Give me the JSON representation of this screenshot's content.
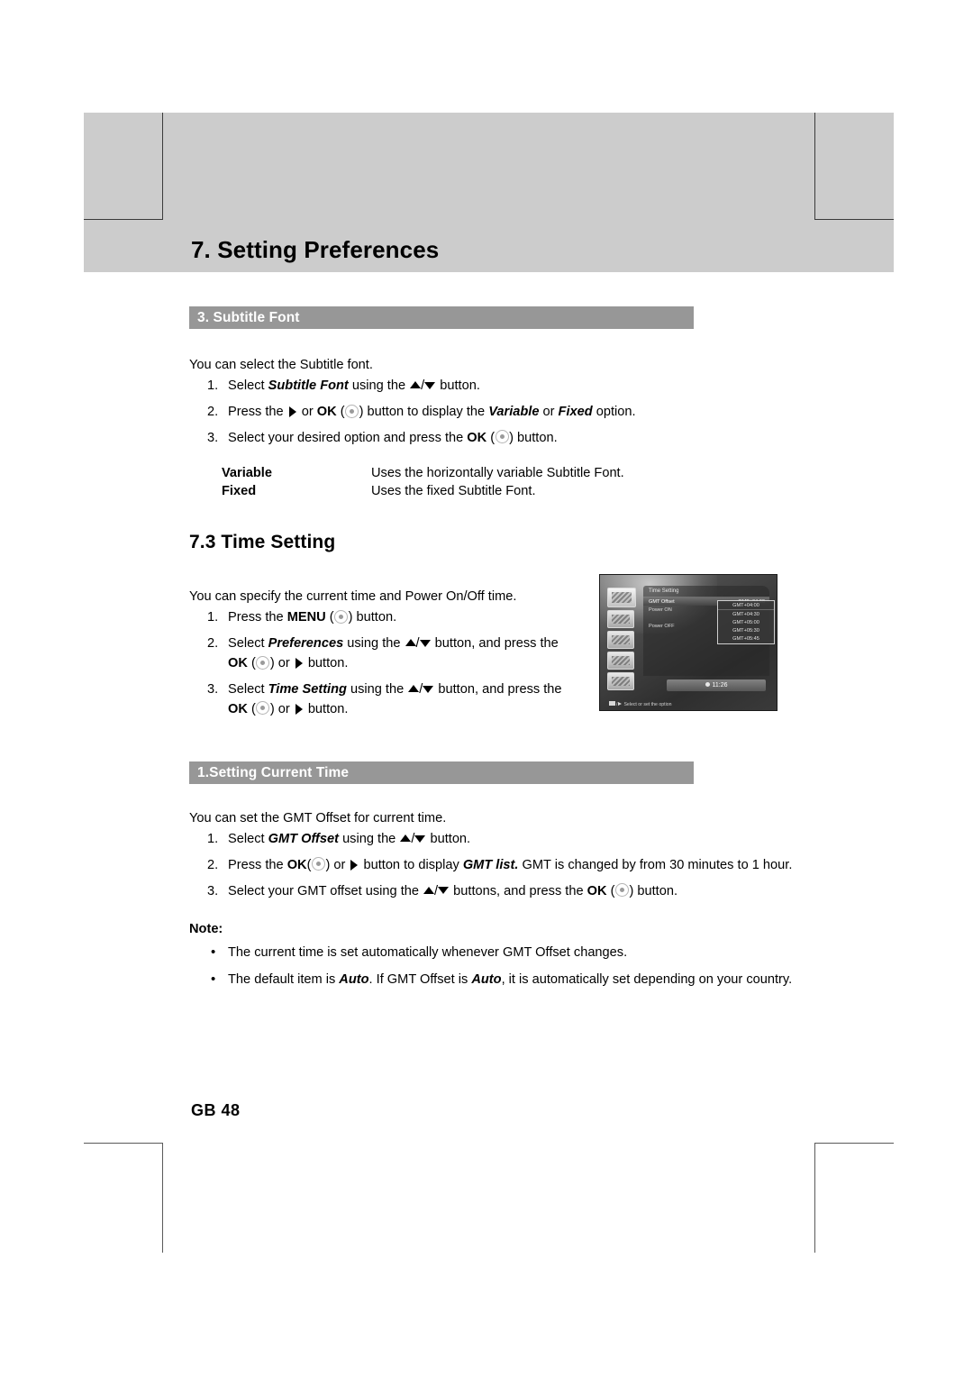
{
  "header": {
    "chapter_title": "7. Setting Preferences"
  },
  "subtitle_font_section": {
    "bar_label": "3. Subtitle Font",
    "intro": "You can select the Subtitle font.",
    "steps": [
      {
        "num": "1.",
        "pre": "Select ",
        "bold_italic": "Subtitle Font",
        "mid": " using the ",
        "post": " button."
      },
      {
        "num": "2.",
        "pre": "Press the ",
        "mid1": " or ",
        "ok": "OK",
        "mid2": ") button to display the ",
        "bold_italic_1": "Variable",
        "mid3": " or ",
        "bold_italic_2": "Fixed",
        "post": " option."
      },
      {
        "num": "3.",
        "pre": "Select your desired option and press the ",
        "ok": "OK",
        "post": ") button."
      }
    ],
    "definitions": [
      {
        "term": "Variable",
        "desc": "Uses the horizontally variable Subtitle Font."
      },
      {
        "term": "Fixed",
        "desc": "Uses the fixed Subtitle Font."
      }
    ]
  },
  "time_setting_section": {
    "heading": "7.3 Time Setting",
    "intro": "You can specify the current time and Power On/Off time.",
    "steps": [
      {
        "num": "1.",
        "pre": "Press the ",
        "bold": "MENU",
        "post": ") button."
      },
      {
        "num": "2.",
        "pre": "Select ",
        "bold_italic": "Preferences",
        "mid": " using the ",
        "post": " button, and press the ",
        "ok": "OK",
        "tail": ") or ",
        "tail2": " button."
      },
      {
        "num": "3.",
        "pre": "Select ",
        "bold_italic": "Time Setting",
        "mid": " using the ",
        "post": " button, and press the ",
        "ok": "OK",
        "tail": ") or ",
        "tail2": " button."
      }
    ]
  },
  "current_time_section": {
    "bar_label": "1.Setting Current Time",
    "intro": "You can set the GMT Offset for current time.",
    "steps": [
      {
        "num": "1.",
        "pre": "Select ",
        "bold_italic": "GMT Offset",
        "mid": " using the ",
        "post": " button."
      },
      {
        "num": "2.",
        "pre": "Press the ",
        "ok": "OK",
        "mid1": ") or ",
        "mid2": " button to display ",
        "bold_italic": "GMT list.",
        "post": " GMT is changed by from 30 minutes to 1 hour."
      },
      {
        "num": "3.",
        "pre": "Select your GMT offset using the ",
        "mid": " buttons, and press the ",
        "ok": "OK",
        "post": ") button."
      }
    ],
    "note_label": "Note:",
    "notes": [
      {
        "bullet": "•",
        "text": "The current time is set automatically whenever GMT Offset changes."
      },
      {
        "bullet": "•",
        "pre": "The default item is ",
        "bold_italic_1": "Auto",
        "mid": ". If GMT Offset is ",
        "bold_italic_2": "Auto",
        "post": ", it is automatically set depending on your country."
      }
    ]
  },
  "tv_screenshot": {
    "panel_title": "Time Setting",
    "rows": [
      {
        "label": "GMT Offset",
        "value": "GMT+04:00"
      },
      {
        "label": "Power ON",
        "value": ""
      },
      {
        "label": "Power OFF",
        "value": ""
      }
    ],
    "dropdown": [
      "GMT+04:00",
      "GMT+04:30",
      "GMT+05:00",
      "GMT+05:30",
      "GMT+05:45"
    ],
    "clock": "11:26",
    "hint": "Select or set the option"
  },
  "footer": {
    "page_number": "GB 48"
  }
}
